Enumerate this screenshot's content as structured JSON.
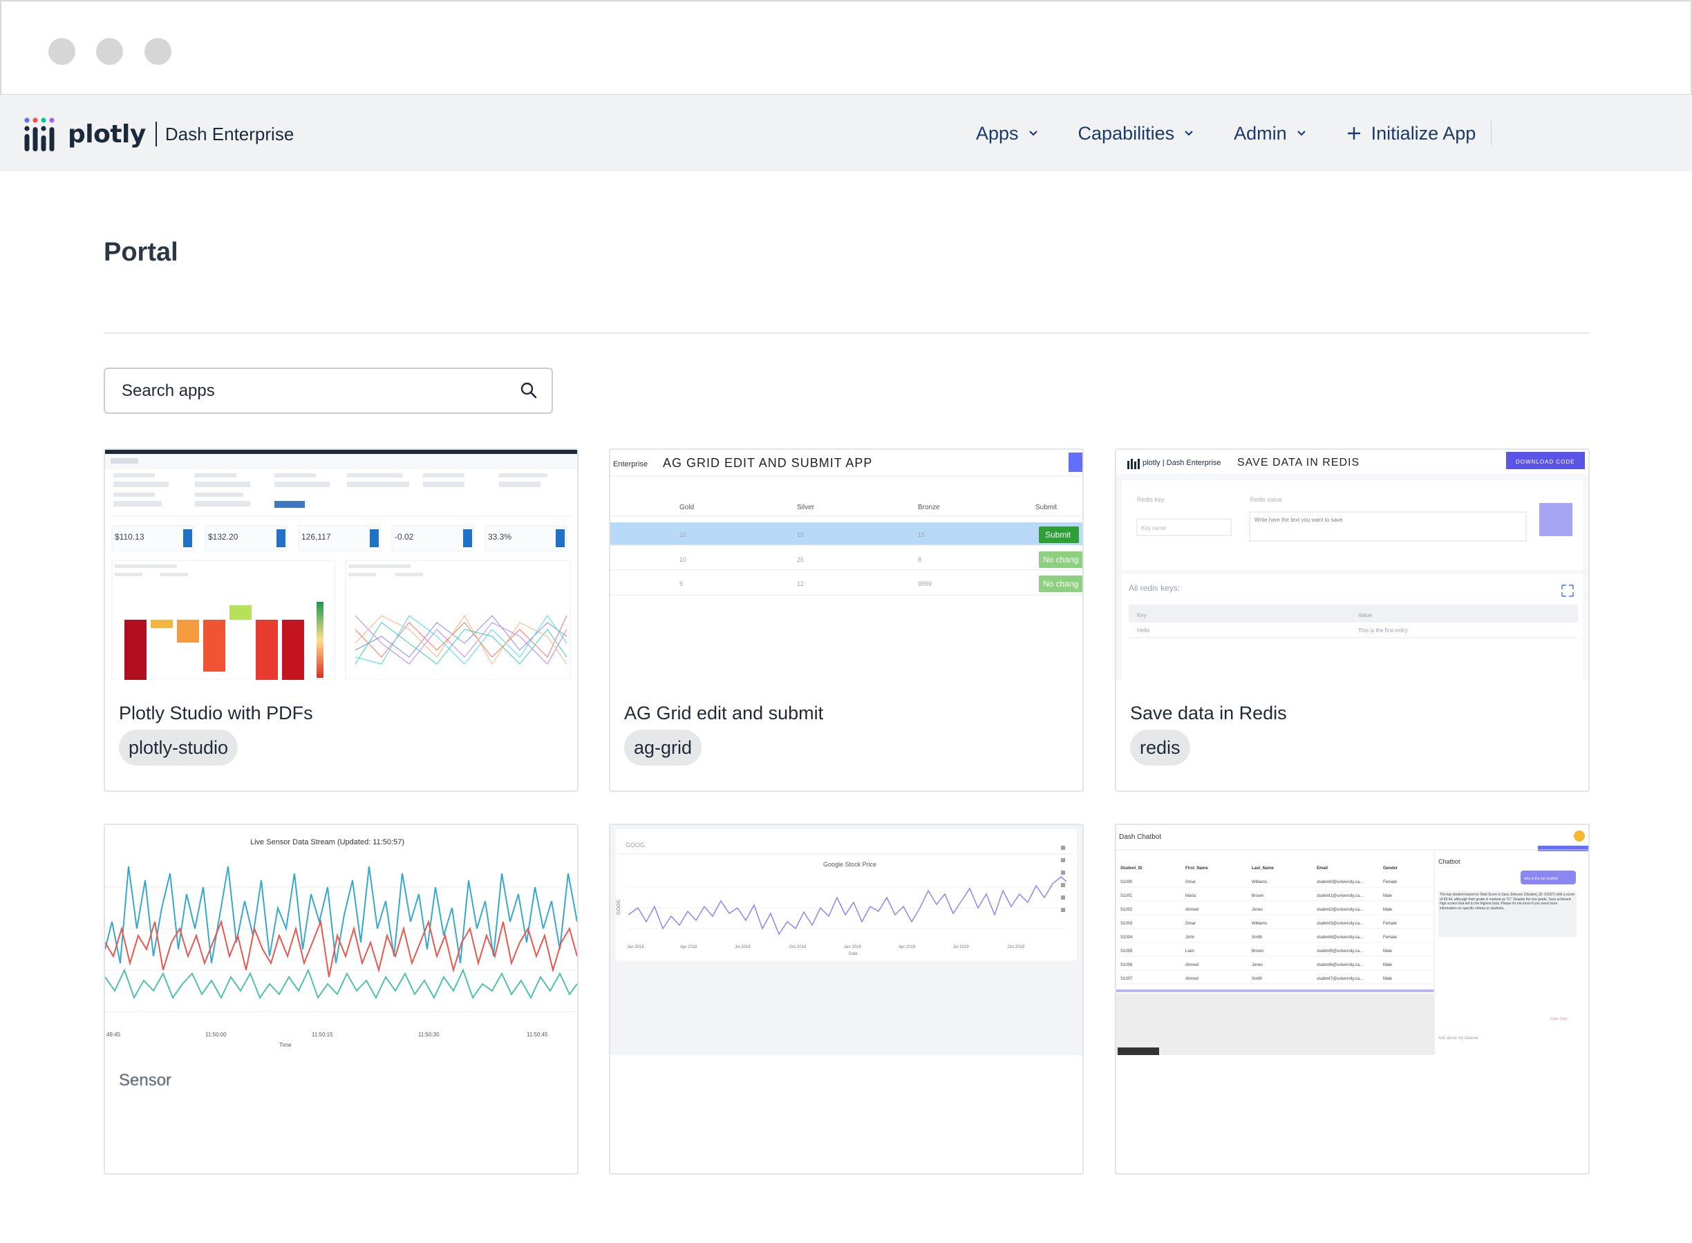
{
  "brand": {
    "word": "plotly",
    "product": "Dash Enterprise"
  },
  "nav": {
    "items": [
      {
        "label": "Apps"
      },
      {
        "label": "Capabilities"
      },
      {
        "label": "Admin"
      }
    ],
    "initialize": "Initialize App"
  },
  "page": {
    "title": "Portal"
  },
  "search": {
    "placeholder": "Search apps",
    "value": ""
  },
  "cards": [
    {
      "title": "Plotly Studio with PDFs",
      "tag": "plotly-studio",
      "thumb": {
        "kpis": [
          "$110.13",
          "$132.20",
          "126,117",
          "-0.02",
          "33.3%"
        ]
      }
    },
    {
      "title": "AG Grid edit and submit",
      "tag": "ag-grid",
      "thumb": {
        "brand": "Enterprise",
        "heading": "AG GRID EDIT AND SUBMIT APP",
        "columns": [
          "Gold",
          "Silver",
          "Bronze",
          "Submit"
        ],
        "rows": [
          {
            "gold": "10",
            "silver": "15",
            "bronze": "15",
            "action": "Submit"
          },
          {
            "gold": "10",
            "silver": "25",
            "bronze": "8",
            "action": "No chang"
          },
          {
            "gold": "5",
            "silver": "12",
            "bronze": "9999",
            "action": "No chang"
          }
        ]
      }
    },
    {
      "title": "Save data in Redis",
      "tag": "redis",
      "thumb": {
        "brand": "plotly | Dash Enterprise",
        "heading": "SAVE DATA IN REDIS",
        "download": "DOWNLOAD CODE",
        "key_label": "Redis key",
        "value_label": "Redis value",
        "key_placeholder": "Key name",
        "value_placeholder": "Write here the text you want to save",
        "all_keys": "All redis keys:",
        "col_key": "Key",
        "col_value": "Value",
        "row_key": "Hello",
        "row_value": "This is the first entry"
      }
    },
    {
      "title": "Sensor",
      "tag": "",
      "thumb": {
        "heading": "Live Sensor Data Stream (Updated: 11:50:57)",
        "ticks": [
          "49:45",
          "11:50:00",
          "11:50:15",
          "11:50:30",
          "11:50:45"
        ],
        "xlabel": "Time"
      }
    },
    {
      "title": "",
      "tag": "",
      "thumb": {
        "ticker": "GOOG",
        "heading": "Google Stock Price",
        "ylabel": "GOOG",
        "xlabel": "Date",
        "ticks": [
          "Jan 2018",
          "Apr 2018",
          "Jul 2018",
          "Oct 2018",
          "Jan 2019",
          "Apr 2019",
          "Jul 2019",
          "Oct 2019"
        ]
      }
    },
    {
      "title": "",
      "tag": "",
      "thumb": {
        "heading": "Dash Chatbot",
        "chat_title": "Chatbot",
        "columns": [
          "Student_ID",
          "First_Name",
          "Last_Name",
          "Email",
          "Gender"
        ],
        "rows": [
          [
            "S1000",
            "Omar",
            "Williams",
            "student0@university.ca...",
            "Female"
          ],
          [
            "S1001",
            "Maria",
            "Brown",
            "student1@university.ca...",
            "Male"
          ],
          [
            "S1002",
            "Ahmed",
            "Jones",
            "student2@university.ca...",
            "Male"
          ],
          [
            "S1003",
            "Omar",
            "Williams",
            "student3@university.ca...",
            "Female"
          ],
          [
            "S1004",
            "John",
            "Smith",
            "student4@university.ca...",
            "Female"
          ],
          [
            "S1005",
            "Liam",
            "Brown",
            "student5@university.ca...",
            "Male"
          ],
          [
            "S1006",
            "Ahmed",
            "Jones",
            "student6@university.ca...",
            "Male"
          ],
          [
            "S1007",
            "Ahmed",
            "Smith",
            "student7@university.ca...",
            "Male"
          ]
        ],
        "user_msg": "who is the top student",
        "bot_msg": "The top student based on Total Score is Sara Johnson (Student_ID: S1027) with a score of 99.44, although their grade is marked as \"D.\" Despite the low grade, Sara achieved high scores that led to the highest total. Please let me know if you need more information on specific criteria or students.",
        "clear": "Clear Chat",
        "ask": "Ask about my dataset"
      }
    }
  ],
  "colors": {
    "nav_text": "#1a3a6b",
    "accent": "#636efa",
    "green": "#4caf50"
  }
}
